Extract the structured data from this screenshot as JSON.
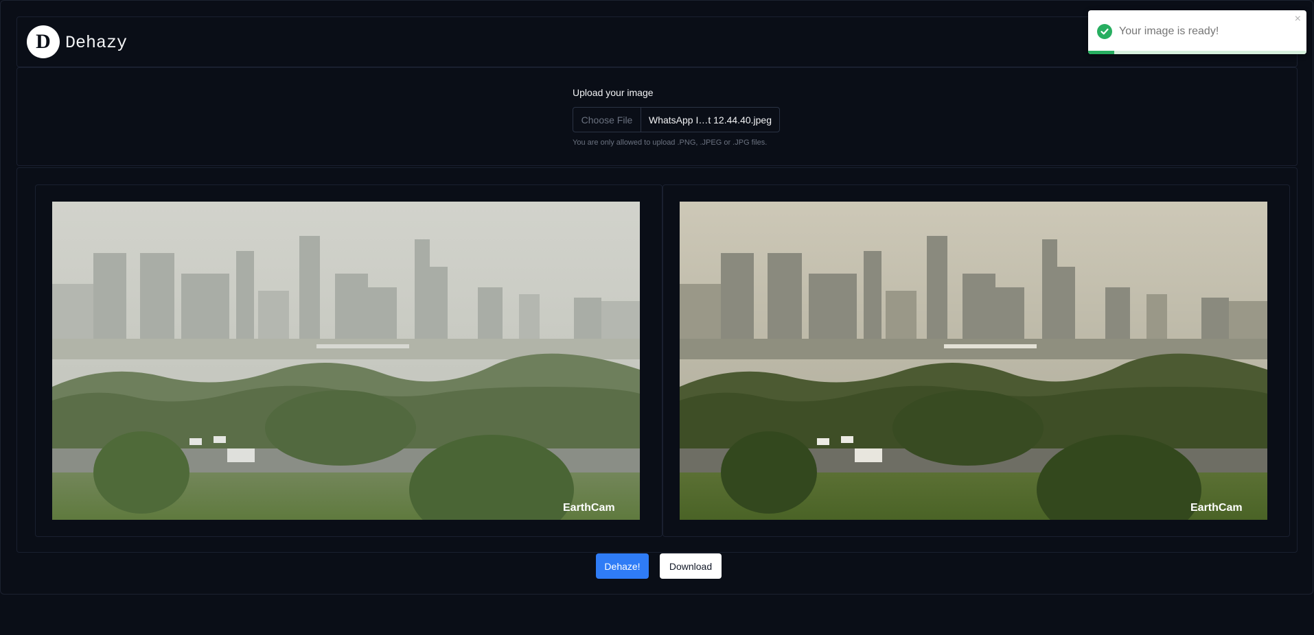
{
  "header": {
    "logo_letter": "D",
    "title": "Dehazy"
  },
  "upload": {
    "label": "Upload your image",
    "choose_file": "Choose File",
    "file_name": "WhatsApp I…t 12.44.40.jpeg",
    "help_text": "You are only allowed to upload .PNG, .JPEG or .JPG files."
  },
  "images": {
    "original_watermark": "EarthCam",
    "dehazed_watermark": "EarthCam"
  },
  "actions": {
    "dehaze_label": "Dehaze!",
    "download_label": "Download"
  },
  "toast": {
    "message": "Your image is ready!",
    "close_symbol": "×",
    "progress": 0.12
  },
  "icons": {
    "logo": "logo-icon",
    "toast_status": "check-circle-icon",
    "toast_close": "close-icon"
  },
  "colors": {
    "primary": "#2f7cf6",
    "success": "#27ae60",
    "background": "#0a0e17"
  }
}
